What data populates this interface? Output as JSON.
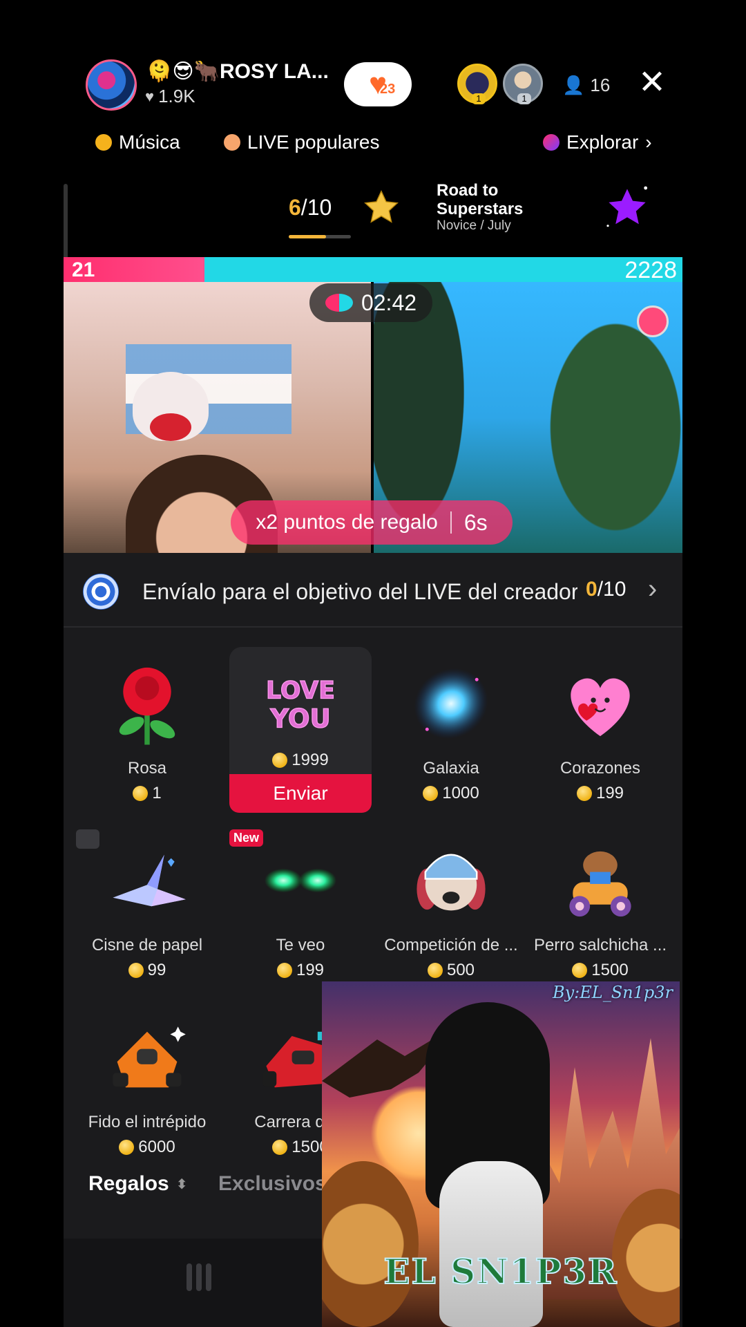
{
  "host": {
    "name": "🫠😎🐂ROSY LA...",
    "likes": "1.9K",
    "follow_count": "23"
  },
  "viewers": {
    "top1_rank": "1",
    "top2_rank": "1",
    "count": "16"
  },
  "chips": {
    "music": "Música",
    "popular": "LIVE populares",
    "explore": "Explorar"
  },
  "road": {
    "progress_current": "6",
    "progress_total": "/10",
    "title_line1": "Road to",
    "title_line2": "Superstars",
    "subtitle": "Novice / July",
    "progress_fraction": 0.6
  },
  "battle": {
    "left_score": "21",
    "right_score": "2228",
    "timer": "02:42",
    "bonus_text": "x2 puntos de regalo",
    "bonus_time": "6s"
  },
  "goal": {
    "text": "Envíalo para el objetivo del LIVE del creador",
    "current": "0",
    "total": "/10"
  },
  "gifts": [
    {
      "name": "Rosa",
      "price": "1",
      "icon": "rose-icon"
    },
    {
      "name": "",
      "price": "1999",
      "icon": "love-you-icon",
      "selected": true,
      "action": "Enviar"
    },
    {
      "name": "Galaxia",
      "price": "1000",
      "icon": "galaxy-icon"
    },
    {
      "name": "Corazones",
      "price": "199",
      "icon": "hearts-icon"
    },
    {
      "name": "Cisne de papel",
      "price": "99",
      "icon": "paper-swan-icon"
    },
    {
      "name": "Te veo",
      "price": "199",
      "icon": "glowing-eyes-icon",
      "badge": "New"
    },
    {
      "name": "Competición de ...",
      "price": "500",
      "icon": "racing-dog-icon"
    },
    {
      "name": "Perro salchicha ...",
      "price": "1500",
      "icon": "dachshund-kart-icon"
    },
    {
      "name": "Fido el intrépido",
      "price": "6000",
      "icon": "race-car-orange-icon"
    },
    {
      "name": "Carrera dina",
      "price": "1500",
      "icon": "race-car-red-icon"
    }
  ],
  "tabs": {
    "gifts": "Regalos",
    "exclusive": "Exclusivos"
  },
  "pip": {
    "signature": "By:EL_Sn1p3r",
    "brand": "EL SN1P3R"
  },
  "colors": {
    "accent_pink": "#ff2e6e",
    "accent_cyan": "#22d8e6",
    "send_red": "#e5133f",
    "gold": "#f4b63a"
  }
}
